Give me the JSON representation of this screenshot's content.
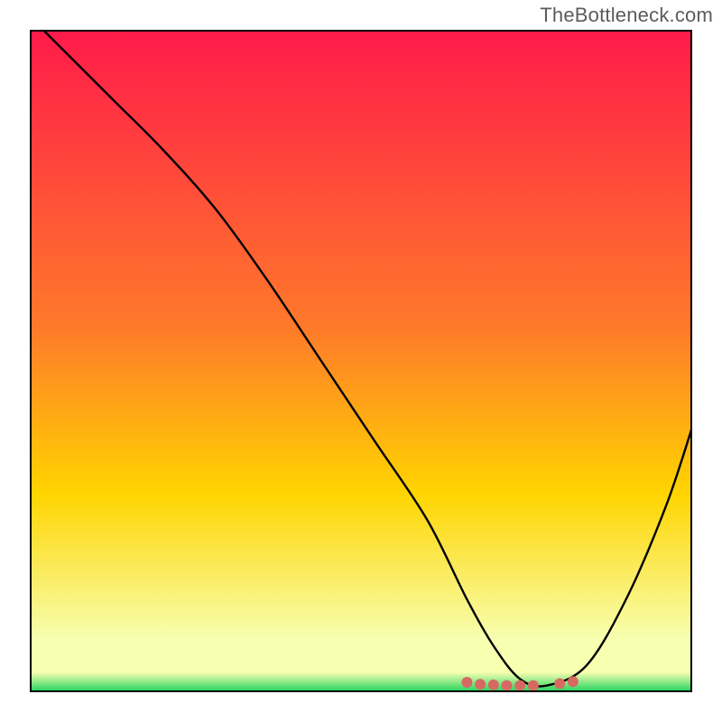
{
  "watermark": "TheBottleneck.com",
  "chart_data": {
    "type": "line",
    "title": "",
    "xlabel": "",
    "ylabel": "",
    "xlim": [
      0,
      100
    ],
    "ylim": [
      0,
      100
    ],
    "grid": false,
    "legend": false,
    "gradient": {
      "top": "#ff1a4a",
      "mid": "#ffd400",
      "bottom_band": "#f7ffb0",
      "base": "#19d159"
    },
    "series": [
      {
        "name": "curve",
        "color": "#000000",
        "x": [
          2,
          12,
          20,
          28,
          36,
          44,
          52,
          60,
          66,
          70,
          74,
          78,
          84,
          90,
          96,
          100
        ],
        "y": [
          100,
          90,
          82,
          73,
          62,
          50,
          38,
          26,
          14,
          7,
          2,
          1,
          4,
          14,
          28,
          40
        ]
      }
    ],
    "markers": {
      "name": "bottom-dots",
      "color": "#d66a63",
      "radius": 6,
      "x": [
        66,
        68,
        70,
        72,
        74,
        76,
        80,
        82
      ],
      "y": [
        1.5,
        1.2,
        1.1,
        1.0,
        1.0,
        1.0,
        1.3,
        1.6
      ]
    }
  }
}
